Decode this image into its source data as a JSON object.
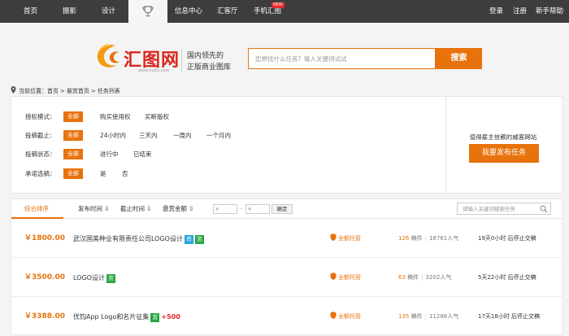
{
  "nav": {
    "items": [
      "首页",
      "摄影",
      "设计",
      "信息中心",
      "汇客厅",
      "手机汇图"
    ],
    "new_badge": "NEW",
    "right": [
      "登录",
      "注册",
      "新手帮助"
    ]
  },
  "header": {
    "logo_text": "汇图网",
    "logo_url": "www.huitu.com",
    "slogan_line1": "国内领先的",
    "slogan_line2": "正版商业图库",
    "search_placeholder": "您想找什么任务？输入关键词试试",
    "search_button": "搜索"
  },
  "breadcrumb": {
    "prefix": "当前位置：",
    "items": [
      "首页",
      "悬赏首页",
      "任务列表"
    ],
    "separator": ">"
  },
  "filters": [
    {
      "label": "授权模式：",
      "all": "全部",
      "options": [
        "购买使用权",
        "买断版权"
      ]
    },
    {
      "label": "投稿截止：",
      "all": "全部",
      "options": [
        "24小时内",
        "三天内",
        "一周内",
        "一个月内"
      ]
    },
    {
      "label": "投稿状态：",
      "all": "全部",
      "options": [
        "进行中",
        "已结束"
      ]
    },
    {
      "label": "承诺选稿：",
      "all": "全部",
      "options": [
        "是",
        "否"
      ]
    }
  ],
  "side": {
    "text": "值得雇主信赖的威客网站",
    "button": "我要发布任务"
  },
  "sortbar": {
    "active": "综合排序",
    "items": [
      "发布时间 ⇩",
      "截止时间 ⇩",
      "悬赏金额 ⇩"
    ],
    "price_from": "¥",
    "price_to": "¥",
    "dash": "-",
    "confirm": "确定",
    "search_placeholder": "请输入关键词搜索任务"
  },
  "tasks": [
    {
      "price": "￥1800.00",
      "title": "武汉国美种业有限责任公司LOGO设计",
      "tags": [
        "荐",
        "赏"
      ],
      "bonus": "",
      "escrow": "全额托管",
      "entries": "126",
      "entries_label": "稿件",
      "views": "18761人气",
      "deadline": "19天0小时 后停止交稿"
    },
    {
      "price": "￥3500.00",
      "title": "LOGO设计",
      "tags": [
        "赏"
      ],
      "bonus": "",
      "escrow": "全额托管",
      "entries": "63",
      "entries_label": "稿件",
      "views": "3202人气",
      "deadline": "5天22小时 后停止交稿"
    },
    {
      "price": "￥3388.00",
      "title": "优钧App Logo和名片征集",
      "tags": [
        "赏"
      ],
      "bonus": "+500",
      "escrow": "全额托管",
      "entries": "135",
      "entries_label": "稿件",
      "views": "11286人气",
      "deadline": "17天18小时 后停止交稿"
    }
  ],
  "colors": {
    "accent": "#e8720c",
    "nav_bg": "#3d3d3d",
    "tag_blue": "#2aa5dc",
    "tag_green": "#28a745"
  }
}
